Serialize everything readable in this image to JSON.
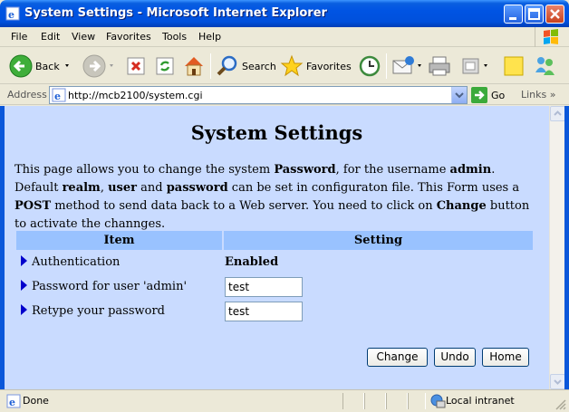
{
  "window": {
    "title": "System Settings - Microsoft Internet Explorer"
  },
  "menu": {
    "items": [
      "File",
      "Edit",
      "View",
      "Favorites",
      "Tools",
      "Help"
    ]
  },
  "toolbar": {
    "back_label": "Back",
    "search_label": "Search",
    "favorites_label": "Favorites"
  },
  "address": {
    "label": "Address",
    "url": "http://mcb2100/system.cgi",
    "go_label": "Go",
    "links_label": "Links"
  },
  "page": {
    "title": "System Settings",
    "description": {
      "p1": "This page allows you to change the system ",
      "b1": "Password",
      "p2": ", for the username ",
      "b2": "admin",
      "p3": ". Default ",
      "b3": "realm",
      "p4": ", ",
      "b4": "user",
      "p5": " and ",
      "b5": "password",
      "p6": " can be set in configuraton file. This Form uses a ",
      "b6": "POST",
      "p7": " method to send data back to a Web server. You need to click on ",
      "b7": "Change",
      "p8": " button to activate the channges."
    },
    "table": {
      "headers": [
        "Item",
        "Setting"
      ],
      "rows": [
        {
          "item": "Authentication",
          "value": "Enabled"
        },
        {
          "item": "Password for user 'admin'",
          "value": "test"
        },
        {
          "item": "Retype your password",
          "value": "test"
        }
      ]
    },
    "buttons": {
      "change": "Change",
      "undo": "Undo",
      "home": "Home"
    }
  },
  "status": {
    "text": "Done",
    "zone": "Local intranet"
  },
  "colors": {
    "content_bg": "#C9DBFF",
    "header_bg": "#99C2FF",
    "titlebar": "#0054E3"
  }
}
